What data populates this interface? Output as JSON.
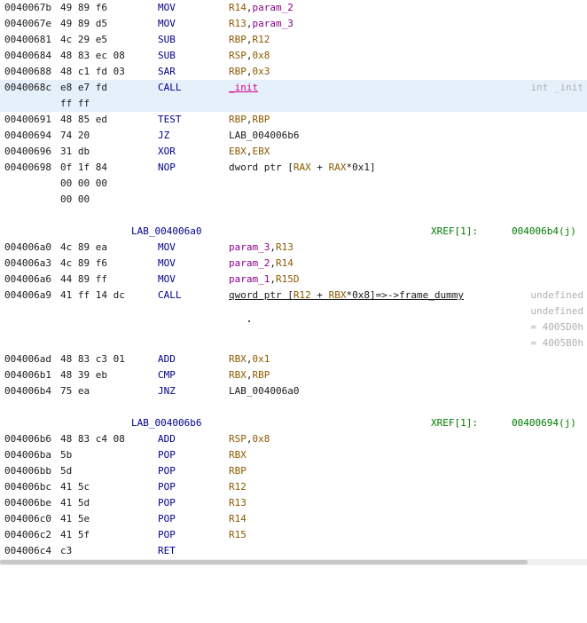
{
  "rows": [
    {
      "addr": "0040067b",
      "bytes": "49 89 f6",
      "mnem": "MOV",
      "op1": "R14",
      "sep": ",",
      "op2": "param_2"
    },
    {
      "addr": "0040067e",
      "bytes": "49 89 d5",
      "mnem": "MOV",
      "op1": "R13",
      "sep": ",",
      "op2": "param_3"
    },
    {
      "addr": "00400681",
      "bytes": "4c 29 e5",
      "mnem": "SUB",
      "op1": "RBP",
      "sep": ",",
      "op2": "R12"
    },
    {
      "addr": "00400684",
      "bytes": "48 83 ec 08",
      "mnem": "SUB",
      "op1": "RSP",
      "sep": ",",
      "op2": "0x8"
    },
    {
      "addr": "00400688",
      "bytes": "48 c1 fd 03",
      "mnem": "SAR",
      "op1": "RBP",
      "sep": ",",
      "op2": "0x3"
    },
    {
      "addr": "0040068c",
      "bytes": "e8 e7 fd",
      "bytes2": "ff ff",
      "mnem": "CALL",
      "op1": "_init",
      "comment": "int _init"
    },
    {
      "addr": "00400691",
      "bytes": "48 85 ed",
      "mnem": "TEST",
      "op1": "RBP",
      "sep": ",",
      "op2": "RBP"
    },
    {
      "addr": "00400694",
      "bytes": "74 20",
      "mnem": "JZ",
      "op1": "LAB_004006b6"
    },
    {
      "addr": "00400696",
      "bytes": "31 db",
      "mnem": "XOR",
      "op1": "EBX",
      "sep": ",",
      "op2": "EBX"
    },
    {
      "addr": "00400698",
      "bytes": "0f 1f 84",
      "bytes2": "00 00 00",
      "bytes3": "00 00",
      "mnem": "NOP",
      "op_prefix": "dword ptr [",
      "op1": "RAX",
      "op_mid": " + ",
      "op2": "RAX",
      "op_suffix": "*0x1]"
    },
    {
      "addr": "004006a0",
      "bytes": "4c 89 ea",
      "mnem": "MOV",
      "op1": "param_3",
      "sep": ",",
      "op2": "R13"
    },
    {
      "addr": "004006a3",
      "bytes": "4c 89 f6",
      "mnem": "MOV",
      "op1": "param_2",
      "sep": ",",
      "op2": "R14"
    },
    {
      "addr": "004006a6",
      "bytes": "44 89 ff",
      "mnem": "MOV",
      "op1": "param_1",
      "sep": ",",
      "op2": "R15D"
    },
    {
      "addr": "004006a9",
      "bytes": "41 ff 14 dc",
      "mnem": "CALL",
      "op_prefix": "qword ptr [",
      "op1": "R12",
      "op_mid": " + ",
      "op2": "RBX",
      "op_suffix": "*0x8]=>->frame_dummy",
      "comments": [
        "undefined",
        "undefined",
        "= 4005D0h",
        "= 4005B0h"
      ]
    },
    {
      "addr": "004006ad",
      "bytes": "48 83 c3 01",
      "mnem": "ADD",
      "op1": "RBX",
      "sep": ",",
      "op2": "0x1"
    },
    {
      "addr": "004006b1",
      "bytes": "48 39 eb",
      "mnem": "CMP",
      "op1": "RBX",
      "sep": ",",
      "op2": "RBP"
    },
    {
      "addr": "004006b4",
      "bytes": "75 ea",
      "mnem": "JNZ",
      "op1": "LAB_004006a0"
    },
    {
      "addr": "004006b6",
      "bytes": "48 83 c4 08",
      "mnem": "ADD",
      "op1": "RSP",
      "sep": ",",
      "op2": "0x8"
    },
    {
      "addr": "004006ba",
      "bytes": "5b",
      "mnem": "POP",
      "op1": "RBX"
    },
    {
      "addr": "004006bb",
      "bytes": "5d",
      "mnem": "POP",
      "op1": "RBP"
    },
    {
      "addr": "004006bc",
      "bytes": "41 5c",
      "mnem": "POP",
      "op1": "R12"
    },
    {
      "addr": "004006be",
      "bytes": "41 5d",
      "mnem": "POP",
      "op1": "R13"
    },
    {
      "addr": "004006c0",
      "bytes": "41 5e",
      "mnem": "POP",
      "op1": "R14"
    },
    {
      "addr": "004006c2",
      "bytes": "41 5f",
      "mnem": "POP",
      "op1": "R15"
    },
    {
      "addr": "004006c4",
      "bytes": "c3",
      "mnem": "RET"
    }
  ],
  "labels": [
    {
      "name": "LAB_004006a0",
      "xref_key": "XREF[1]:",
      "xref_val": "004006b4(j)"
    },
    {
      "name": "LAB_004006b6",
      "xref_key": "XREF[1]:",
      "xref_val": "00400694(j)"
    }
  ],
  "colors": {
    "selection": "#e6f0fb",
    "mnemonic": "#00008b",
    "register": "#8b5a00",
    "parameter": "#8b008b",
    "function": "#d4008a",
    "xref": "#007a00",
    "comment": "#b0b0b0"
  }
}
